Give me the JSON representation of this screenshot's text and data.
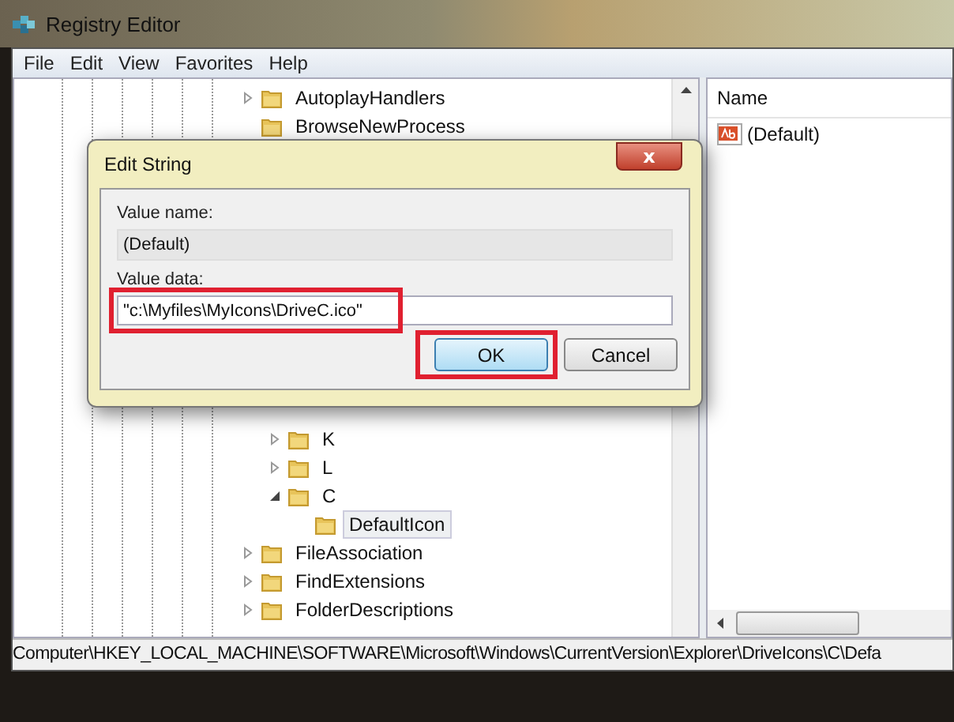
{
  "window": {
    "title": "Registry Editor"
  },
  "menu": [
    "File",
    "Edit",
    "View",
    "Favorites",
    "Help"
  ],
  "tree": {
    "items": [
      {
        "label": "AutoplayHandlers",
        "expanded": false,
        "selected": false
      },
      {
        "label": "BrowseNewProcess",
        "selected": false
      },
      {
        "children": [
          {
            "label": "K",
            "expanded": false,
            "selected": false
          },
          {
            "label": "L",
            "expanded": false,
            "selected": false
          },
          {
            "label": "C",
            "expanded": true,
            "selected": false,
            "children": [
              {
                "label": "DefaultIcon",
                "selected": true
              }
            ]
          }
        ]
      },
      {
        "label": "FileAssociation",
        "expanded": false,
        "selected": false
      },
      {
        "label": "FindExtensions",
        "expanded": false,
        "selected": false
      },
      {
        "label": "FolderDescriptions",
        "expanded": false,
        "selected": false
      }
    ]
  },
  "values": {
    "columns": [
      "Name"
    ],
    "rows": [
      {
        "name": "(Default)",
        "selected": false
      }
    ]
  },
  "dialog": {
    "title": "Edit String",
    "close": "x",
    "value_name": {
      "label": "Value name:",
      "value": "(Default)"
    },
    "value_data": {
      "label": "Value data:",
      "value": "\"c:\\Myfiles\\MyIcons\\DriveC.ico\"",
      "highlighted": true
    },
    "buttons": [
      {
        "label": "OK",
        "default": true,
        "highlighted": true
      },
      {
        "label": "Cancel",
        "default": false,
        "highlighted": false
      }
    ]
  },
  "status_bar": "Computer\\HKEY_LOCAL_MACHINE\\SOFTWARE\\Microsoft\\Windows\\CurrentVersion\\Explorer\\DriveIcons\\C\\Defa"
}
